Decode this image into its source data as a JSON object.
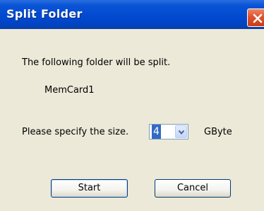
{
  "window": {
    "title": "Split Folder"
  },
  "dialog": {
    "message": "The following folder will be split.",
    "folder_name": "MemCard1",
    "size_prompt": "Please specify the size.",
    "size_value": "4",
    "size_unit": "GByte"
  },
  "buttons": {
    "start_label": "Start",
    "cancel_label": "Cancel"
  },
  "icons": {
    "close": "close-icon",
    "dropdown": "chevron-down-icon"
  },
  "colors": {
    "titlebar": "#0a54d6",
    "client": "#ece9d8",
    "close_button": "#e0522c",
    "selection": "#316ac5"
  }
}
